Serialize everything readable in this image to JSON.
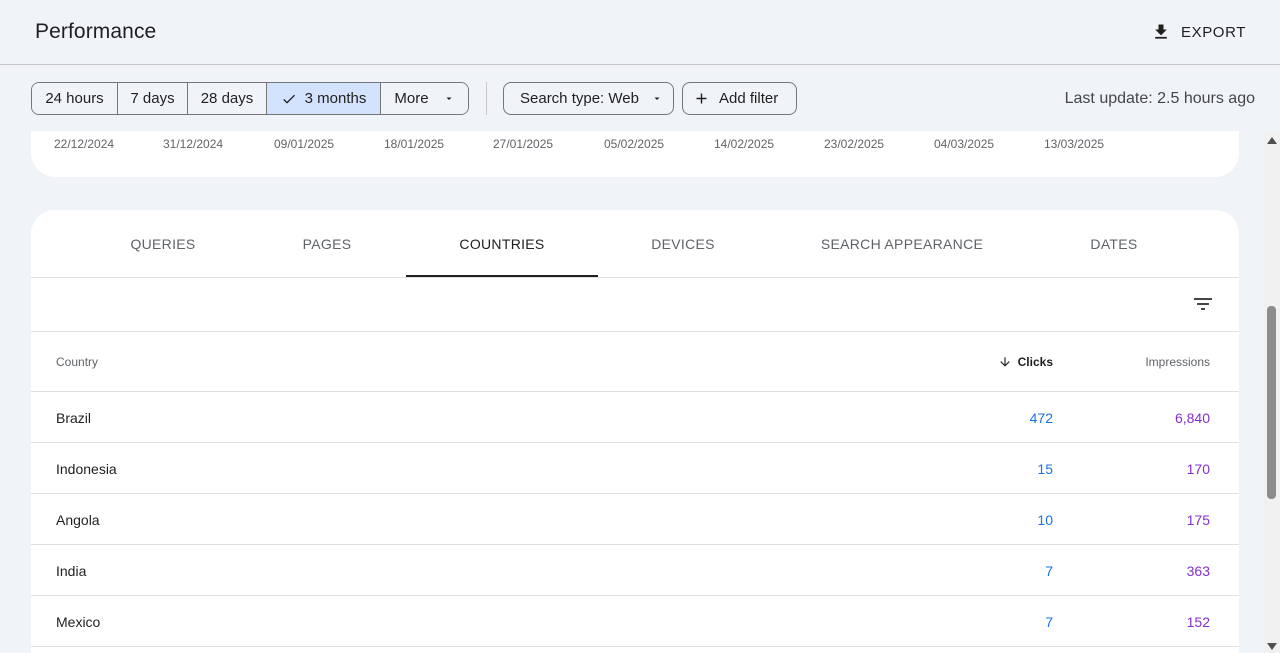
{
  "header": {
    "title": "Performance",
    "export_label": "EXPORT"
  },
  "filters": {
    "ranges": [
      {
        "label": "24 hours",
        "active": false
      },
      {
        "label": "7 days",
        "active": false
      },
      {
        "label": "28 days",
        "active": false
      },
      {
        "label": "3 months",
        "active": true
      },
      {
        "label": "More",
        "active": false
      }
    ],
    "search_type_label": "Search type: Web",
    "add_filter_label": "Add filter",
    "last_update": "Last update: 2.5 hours ago"
  },
  "chart": {
    "x_ticks": [
      "22/12/2024",
      "31/12/2024",
      "09/01/2025",
      "18/01/2025",
      "27/01/2025",
      "05/02/2025",
      "14/02/2025",
      "23/02/2025",
      "04/03/2025",
      "13/03/2025"
    ]
  },
  "tabs": [
    {
      "label": "QUERIES",
      "active": false
    },
    {
      "label": "PAGES",
      "active": false
    },
    {
      "label": "COUNTRIES",
      "active": true
    },
    {
      "label": "DEVICES",
      "active": false
    },
    {
      "label": "SEARCH APPEARANCE",
      "active": false
    },
    {
      "label": "DATES",
      "active": false
    }
  ],
  "table": {
    "columns": {
      "country": "Country",
      "clicks": "Clicks",
      "impressions": "Impressions"
    },
    "rows": [
      {
        "country": "Brazil",
        "clicks": "472",
        "impressions": "6,840"
      },
      {
        "country": "Indonesia",
        "clicks": "15",
        "impressions": "170"
      },
      {
        "country": "Angola",
        "clicks": "10",
        "impressions": "175"
      },
      {
        "country": "India",
        "clicks": "7",
        "impressions": "363"
      },
      {
        "country": "Mexico",
        "clicks": "7",
        "impressions": "152"
      }
    ]
  },
  "colors": {
    "clicks": "#1a73e8",
    "impressions": "#8430ce",
    "active_range": "#d3e3fd"
  },
  "icons": {
    "export": "download-icon",
    "active_range": "check-icon",
    "dropdown": "caret-down-icon",
    "add_filter": "plus-icon",
    "table_filter": "filter-icon",
    "sort": "arrow-down-icon"
  }
}
